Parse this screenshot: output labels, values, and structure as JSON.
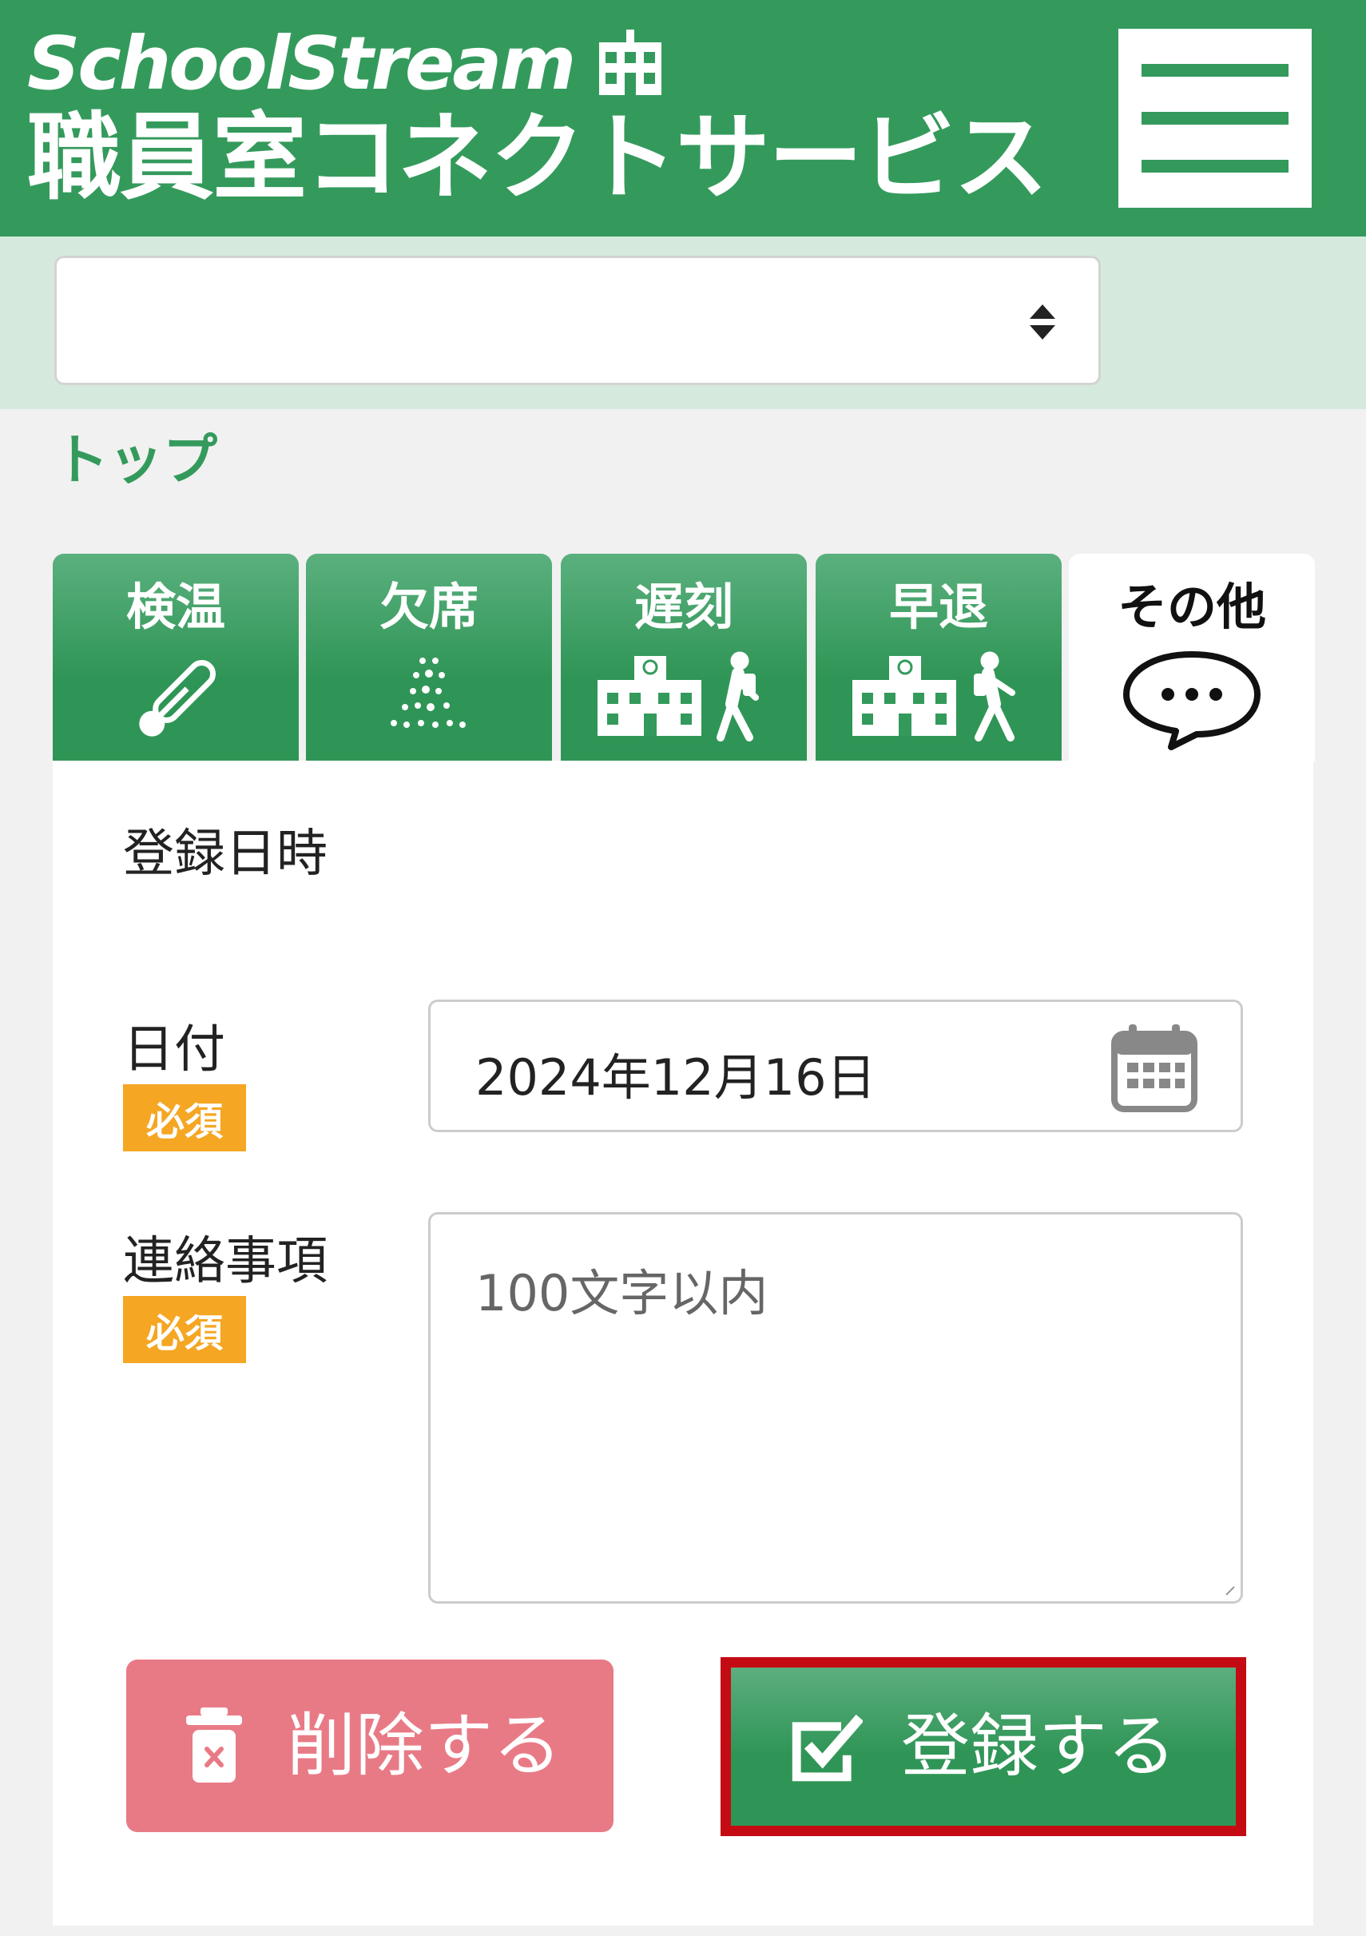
{
  "header": {
    "brand": "SchoolStream",
    "service_name": "職員室コネクトサービス",
    "menu_icon": "hamburger-menu-icon",
    "color": "#349a5c"
  },
  "selector": {
    "value": "",
    "icon": "sort-arrows-icon"
  },
  "breadcrumb": {
    "top": "トップ"
  },
  "tabs": [
    {
      "label": "検温",
      "icon": "thermometer-icon",
      "active": false
    },
    {
      "label": "欠席",
      "icon": "sparkle-dots-icon",
      "active": false
    },
    {
      "label": "遅刻",
      "icon": "school-walker-icon",
      "active": false
    },
    {
      "label": "早退",
      "icon": "school-walker-icon",
      "active": false
    },
    {
      "label": "その他",
      "icon": "speech-bubble-icon",
      "active": true
    }
  ],
  "form": {
    "section_title": "登録日時",
    "date": {
      "label": "日付",
      "required": "必須",
      "value": "2024年12月16日",
      "icon": "calendar-icon"
    },
    "message": {
      "label": "連絡事項",
      "required": "必須",
      "placeholder": "100文字以内",
      "value": ""
    }
  },
  "buttons": {
    "delete": {
      "label": "削除する",
      "icon": "trash-icon",
      "color": "#e87a86"
    },
    "submit": {
      "label": "登録する",
      "icon": "checkbox-icon",
      "color": "#349a5c",
      "highlight": "#c40b13"
    }
  }
}
